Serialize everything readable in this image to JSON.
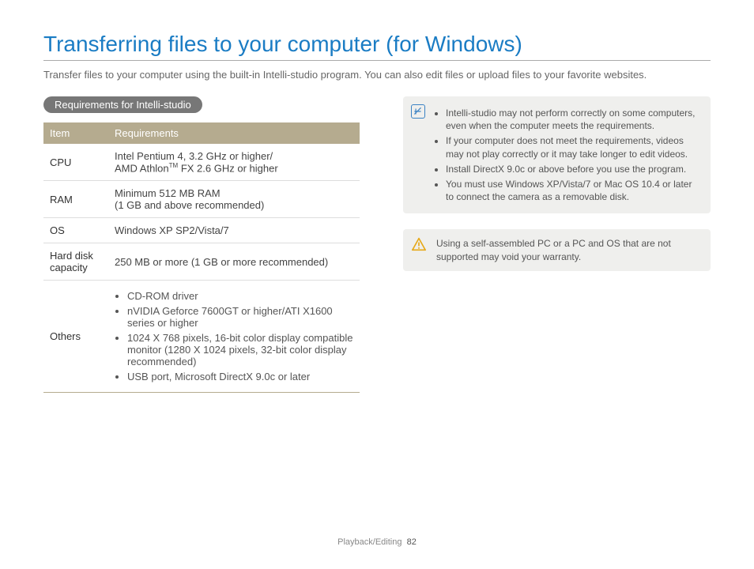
{
  "title": "Transferring files to your computer (for Windows)",
  "intro": "Transfer files to your computer using the built-in Intelli-studio program. You can also edit files or upload files to your favorite websites.",
  "section_label": "Requirements for Intelli-studio",
  "table": {
    "head_item": "Item",
    "head_req": "Requirements",
    "rows": {
      "cpu_label": "CPU",
      "cpu_line1": "Intel Pentium 4, 3.2 GHz or higher/",
      "cpu_line2a": "AMD Athlon",
      "cpu_line2b": " FX 2.6 GHz or higher",
      "ram_label": "RAM",
      "ram_line1": "Minimum 512 MB RAM",
      "ram_line2": "(1 GB and above recommended)",
      "os_label": "OS",
      "os_val": "Windows XP SP2/Vista/7",
      "hd_label": "Hard disk capacity",
      "hd_val": "250 MB or more (1 GB or more recommended)",
      "others_label": "Others",
      "others_li1": "CD-ROM driver",
      "others_li2": "nVIDIA Geforce 7600GT or higher/ATI X1600 series or higher",
      "others_li3": "1024 X 768 pixels, 16-bit color display compatible monitor (1280 X 1024 pixels, 32-bit color display recommended)",
      "others_li4": "USB port, Microsoft DirectX 9.0c or later"
    }
  },
  "notes": {
    "n1": "Intelli-studio may not perform correctly on some computers, even when the computer meets the requirements.",
    "n2": "If your computer does not meet the requirements, videos may not play correctly or it may take longer to edit videos.",
    "n3": "Install DirectX 9.0c or above before you use the program.",
    "n4": "You must use Windows XP/Vista/7 or Mac OS 10.4 or later to connect the camera as a removable disk."
  },
  "warning": "Using a self-assembled PC or a PC and OS that are not supported may void your warranty.",
  "footer_section": "Playback/Editing",
  "footer_page": "82",
  "tm": "TM"
}
